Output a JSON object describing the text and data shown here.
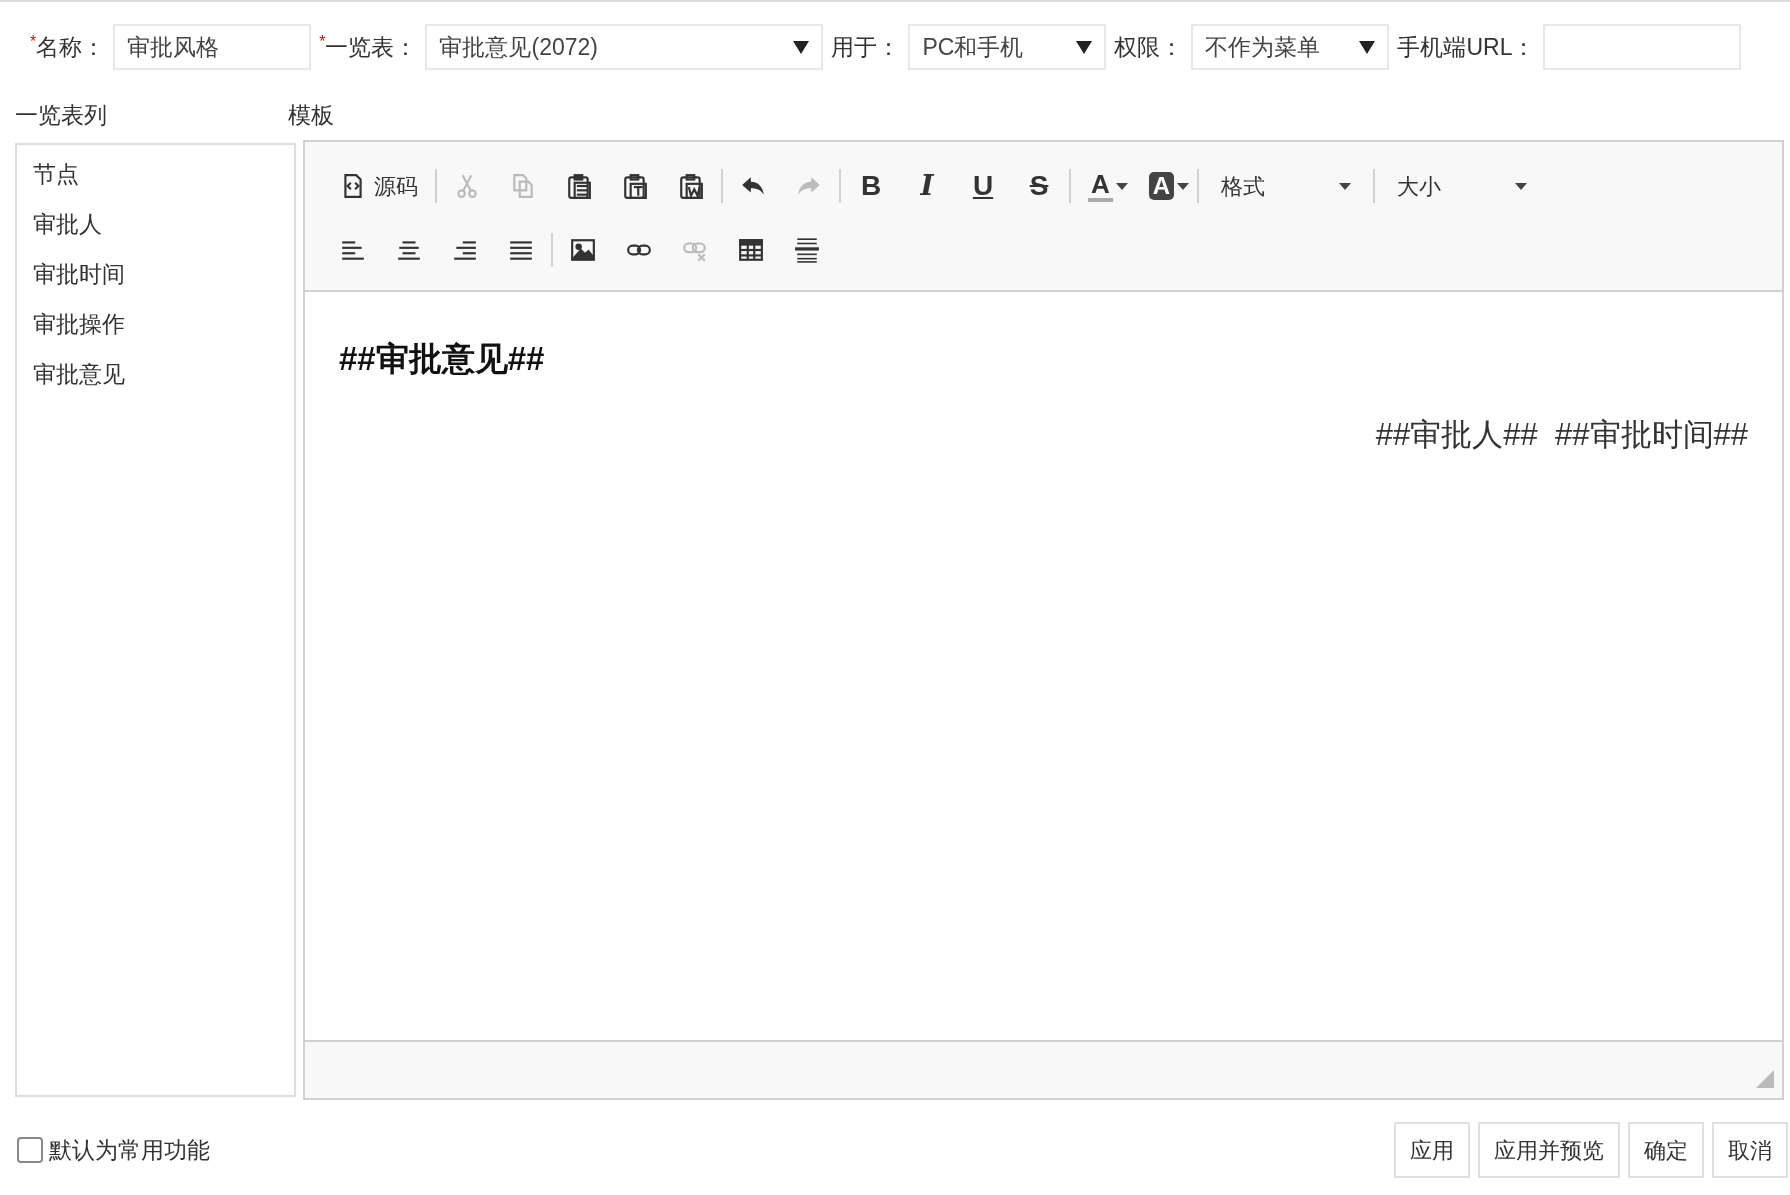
{
  "form": {
    "fields": [
      {
        "kind": "text",
        "mark": "*",
        "label": "名称：",
        "value": "审批风格"
      },
      {
        "kind": "select",
        "mark": "*",
        "label": "一览表：",
        "value": "审批意见(2072)"
      },
      {
        "kind": "select",
        "label": "用于：",
        "value": "PC和手机"
      },
      {
        "kind": "select",
        "label": "权限：",
        "value": "不作为菜单"
      },
      {
        "kind": "text",
        "label": "手机端URL："
      }
    ]
  },
  "columns_panel": {
    "title": "一览表列",
    "items": [
      "节点",
      "审批人",
      "审批时间",
      "审批操作",
      "审批意见"
    ]
  },
  "editor": {
    "title": "模板",
    "toolbar": {
      "rows": [
        [
          {
            "kind": "source",
            "label": "源码",
            "disabled": false
          },
          {
            "kind": "separator"
          },
          {
            "kind": "cut",
            "disabled": true
          },
          {
            "kind": "copy",
            "disabled": true
          },
          {
            "kind": "paste",
            "disabled": false
          },
          {
            "kind": "paste-text",
            "disabled": false
          },
          {
            "kind": "paste-word",
            "disabled": false
          },
          {
            "kind": "separator"
          },
          {
            "kind": "undo",
            "disabled": false
          },
          {
            "kind": "redo",
            "disabled": true
          },
          {
            "kind": "separator"
          },
          {
            "kind": "bold",
            "label": "B",
            "disabled": false
          },
          {
            "kind": "italic",
            "label": "I",
            "disabled": false
          },
          {
            "kind": "underline",
            "label": "U",
            "disabled": false
          },
          {
            "kind": "strike",
            "label": "S",
            "disabled": false
          },
          {
            "kind": "separator"
          },
          {
            "kind": "text-color",
            "label": "A",
            "disabled": false
          },
          {
            "kind": "bg-color",
            "label": "A",
            "disabled": false
          },
          {
            "kind": "separator"
          },
          {
            "kind": "combo",
            "label": "格式",
            "disabled": false
          },
          {
            "kind": "separator"
          },
          {
            "kind": "combo",
            "label": "大小",
            "disabled": false
          }
        ],
        [
          {
            "kind": "align-left",
            "disabled": false
          },
          {
            "kind": "align-center",
            "disabled": false
          },
          {
            "kind": "align-right",
            "disabled": false
          },
          {
            "kind": "justify",
            "disabled": false
          },
          {
            "kind": "separator"
          },
          {
            "kind": "image",
            "disabled": false
          },
          {
            "kind": "link",
            "disabled": false
          },
          {
            "kind": "unlink",
            "disabled": true
          },
          {
            "kind": "table",
            "disabled": false
          },
          {
            "kind": "rule",
            "disabled": false
          }
        ]
      ]
    },
    "content": [
      {
        "kind": "heading",
        "text": "##审批意见##"
      },
      {
        "kind": "right",
        "text": "##审批人##  ##审批时间##"
      }
    ]
  },
  "default_option": {
    "label": "默认为常用功能",
    "checked": false
  },
  "buttons": [
    "应用",
    "应用并预览",
    "确定",
    "取消"
  ]
}
